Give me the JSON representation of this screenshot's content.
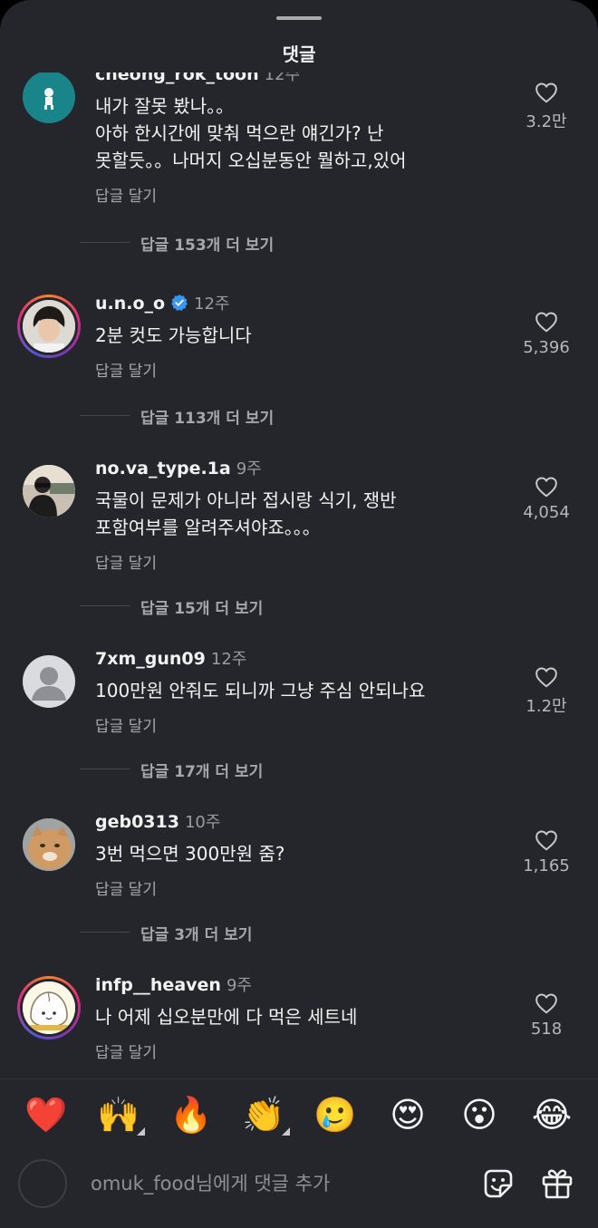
{
  "sheet_title": "댓글",
  "comments": [
    {
      "username": "cheong_rok_toon",
      "time": "12주",
      "text_lines": [
        "내가 잘못 봤나。。",
        "아하 한시간에 맞춰 먹으란 얘긴가? 난",
        "못할듯。。나머지 오십분동안 뭘하고,있어"
      ],
      "reply_label": "답글 달기",
      "more_replies": "답글 153개 더 보기",
      "likes": "3.2만",
      "verified": false
    },
    {
      "username": "u.n.o_o",
      "time": "12주",
      "text_lines": [
        "2분 컷도 가능합니다"
      ],
      "reply_label": "답글 달기",
      "more_replies": "답글 113개 더 보기",
      "likes": "5,396",
      "verified": true
    },
    {
      "username": "no.va_type.1a",
      "time": "9주",
      "text_lines": [
        "국물이 문제가 아니라 접시랑 식기, 쟁반",
        "포함여부를 알려주셔야죠。。。"
      ],
      "reply_label": "답글 달기",
      "more_replies": "답글 15개 더 보기",
      "likes": "4,054",
      "verified": false
    },
    {
      "username": "7xm_gun09",
      "time": "12주",
      "text_lines": [
        "100만원 안줘도 되니까 그냥 주심 안되나요"
      ],
      "reply_label": "답글 달기",
      "more_replies": "답글 17개 더 보기",
      "likes": "1.2만",
      "verified": false
    },
    {
      "username": "geb0313",
      "time": "10주",
      "text_lines": [
        "3번 먹으면 300만원 줌?"
      ],
      "reply_label": "답글 달기",
      "more_replies": "답글 3개 더 보기",
      "likes": "1,165",
      "verified": false
    },
    {
      "username": "infp__heaven",
      "time": "9주",
      "text_lines": [
        "나 어제 십오분만에 다 먹은 세트네"
      ],
      "reply_label": "답글 달기",
      "more_replies": "",
      "likes": "518",
      "verified": false
    }
  ],
  "emoji_reactions": [
    "❤️",
    "🙌",
    "🔥",
    "👏",
    "🥲",
    "😍",
    "😮",
    "😂"
  ],
  "composer": {
    "placeholder": "omuk_food님에게 댓글 추가"
  },
  "icons": {
    "like": "heart-outline-icon",
    "sticker": "sticker-icon",
    "gift": "gift-icon",
    "verified": "verified-badge-icon"
  },
  "colors": {
    "background": "#25262b",
    "verified": "#3897f0"
  }
}
